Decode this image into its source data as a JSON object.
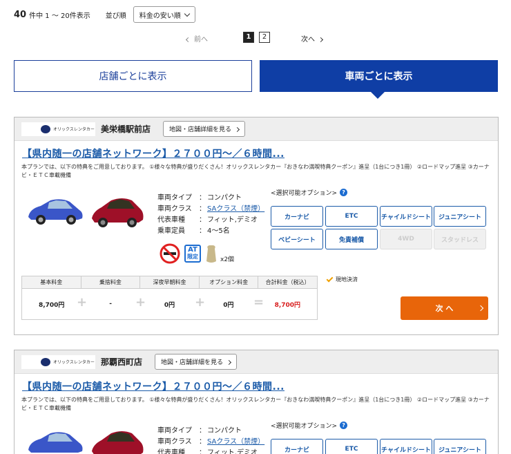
{
  "results": {
    "count": "40",
    "range_text": "件中 1 ～ 20件表示"
  },
  "sort": {
    "label": "並び順",
    "selected": "料金の安い順"
  },
  "pager": {
    "prev": "前へ",
    "current": "1",
    "page2": "2",
    "next": "次へ"
  },
  "view_tabs": {
    "store": "店舗ごとに表示",
    "car": "車両ごとに表示"
  },
  "colors": {
    "primary": "#0f3ea5",
    "link": "#1a5aa8",
    "cta": "#e8650a",
    "total_price": "#d81e1e"
  },
  "cards": [
    {
      "logo_text": "オリックスレンタカー",
      "store_name": "美栄橋駅前店",
      "map_button": "地図・店舗詳細を見る",
      "plan_title": "【県内随一の店舗ネットワーク】２７００円～／６時間...",
      "plan_desc": "本プランでは、以下の特典をご用意しております。 ①様々な特典が盛りだくさん！オリックスレンタカー『おきなわ満喫特典クーポン』進呈（1台につき1冊） ②ロードマップ進呈 ③カーナビ・ＥＴＣ車載機備",
      "specs": {
        "type_label": "車両タイプ",
        "type_value": "コンパクト",
        "class_label": "車両クラス",
        "class_value": "SAクラス（禁煙）",
        "model_label": "代表車種",
        "model_value": "フィット,デミオ",
        "capacity_label": "乗車定員",
        "capacity_value": "4～5名",
        "colon": "："
      },
      "icons": {
        "at_top": "AT",
        "at_bottom": "限定",
        "seats": "x2個"
      },
      "options_label": "<選択可能オプション>",
      "options_help": "?",
      "options": [
        {
          "label": "カーナビ",
          "enabled": true
        },
        {
          "label": "ETC",
          "enabled": true
        },
        {
          "label": "チャイルドシート",
          "enabled": true
        },
        {
          "label": "ジュニアシート",
          "enabled": true
        },
        {
          "label": "ベビーシート",
          "enabled": true
        },
        {
          "label": "免責補償",
          "enabled": true
        },
        {
          "label": "4WD",
          "enabled": false
        },
        {
          "label": "スタッドレス",
          "enabled": false
        }
      ],
      "price_headers": [
        "基本料金",
        "乗捨料金",
        "深夜早朝料金",
        "オプション料金",
        "合計料金（税込）"
      ],
      "price_values": [
        "8,700円",
        "-",
        "0円",
        "0円",
        "8,700円"
      ],
      "operators": {
        "plus": "+",
        "equals": "="
      },
      "payment_note": "現地決済",
      "next_button": "次 へ"
    },
    {
      "logo_text": "オリックスレンタカー",
      "store_name": "那覇西町店",
      "map_button": "地図・店舗詳細を見る",
      "plan_title": "【県内随一の店舗ネットワーク】２７００円～／６時間...",
      "plan_desc": "本プランでは、以下の特典をご用意しております。 ①様々な特典が盛りだくさん！オリックスレンタカー『おきなわ満喫特典クーポン』進呈（1台につき1冊） ②ロードマップ進呈 ③カーナビ・ＥＴＣ車載機備",
      "specs": {
        "type_label": "車両タイプ",
        "type_value": "コンパクト",
        "class_label": "車両クラス",
        "class_value": "SAクラス（禁煙）",
        "model_label": "代表車種",
        "model_value": "フィット,デミオ",
        "colon": "："
      },
      "options_label": "<選択可能オプション>",
      "options_help": "?",
      "options": [
        {
          "label": "カーナビ",
          "enabled": true
        },
        {
          "label": "ETC",
          "enabled": true
        },
        {
          "label": "チャイルドシート",
          "enabled": true
        },
        {
          "label": "ジュニアシート",
          "enabled": true
        }
      ]
    }
  ]
}
